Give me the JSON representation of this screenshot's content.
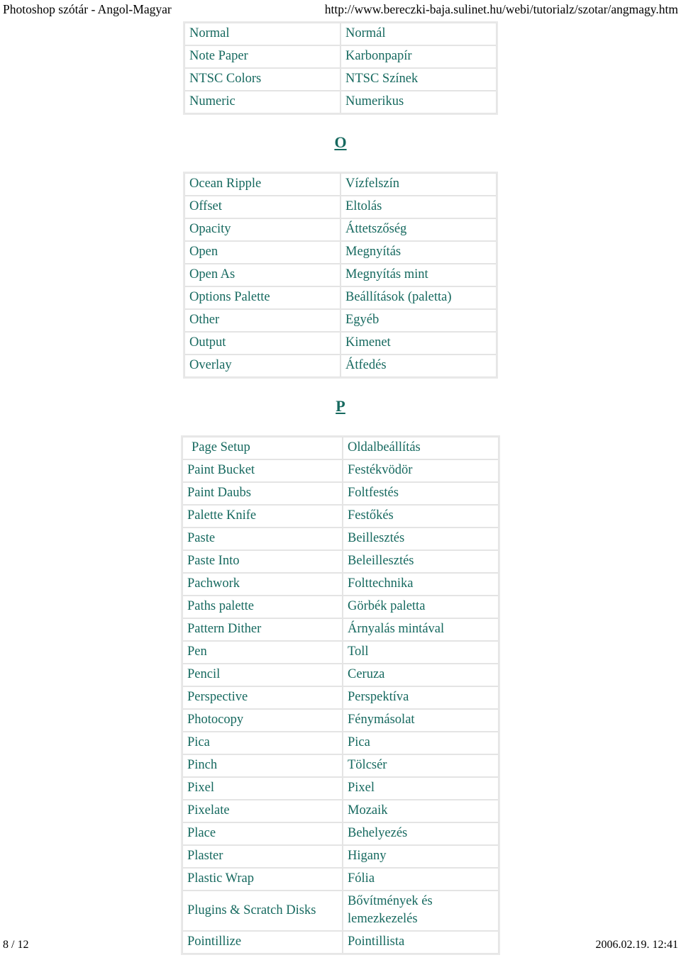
{
  "print_header": {
    "title": "Photoshop szótár - Angol-Magyar",
    "url": "http://www.bereczki-baja.sulinet.hu/webi/tutorialz/szotar/angmagy.htm"
  },
  "print_footer": {
    "page": "8 / 12",
    "timestamp": "2006.02.19. 12:41"
  },
  "colors": {
    "text_teal": "#16695f",
    "table_border": "#e4e4e4",
    "table_outer_border": "#e9e9e9",
    "header_text": "#000000",
    "background": "#ffffff"
  },
  "sections": [
    {
      "id": "section-n-continued",
      "letter": null,
      "rows": [
        {
          "en": "Normal",
          "hu": "Normál"
        },
        {
          "en": "Note Paper",
          "hu": "Karbonpapír"
        },
        {
          "en": "NTSC Colors",
          "hu": "NTSC Színek"
        },
        {
          "en": "Numeric",
          "hu": "Numerikus"
        }
      ]
    },
    {
      "id": "section-o",
      "letter": "O",
      "rows": [
        {
          "en": "Ocean Ripple",
          "hu": "Vízfelszín"
        },
        {
          "en": "Offset",
          "hu": "Eltolás"
        },
        {
          "en": "Opacity",
          "hu": "Áttetszőség"
        },
        {
          "en": "Open",
          "hu": "Megnyítás"
        },
        {
          "en": "Open As",
          "hu": "Megnyítás mint"
        },
        {
          "en": "Options Palette",
          "hu": "Beállítások (paletta)"
        },
        {
          "en": "Other",
          "hu": "Egyéb"
        },
        {
          "en": "Output",
          "hu": "Kimenet"
        },
        {
          "en": "Overlay",
          "hu": "Átfedés"
        }
      ]
    },
    {
      "id": "section-p",
      "letter": "P",
      "rows": [
        {
          "en": "Page Setup",
          "hu": "Oldalbeállítás",
          "indented": true
        },
        {
          "en": "Paint Bucket",
          "hu": "Festékvödör"
        },
        {
          "en": "Paint Daubs",
          "hu": "Foltfestés"
        },
        {
          "en": "Palette Knife",
          "hu": "Festőkés"
        },
        {
          "en": "Paste",
          "hu": "Beillesztés"
        },
        {
          "en": "Paste Into",
          "hu": "Beleillesztés"
        },
        {
          "en": "Pachwork",
          "hu": "Folttechnika"
        },
        {
          "en": "Paths palette",
          "hu": "Görbék paletta"
        },
        {
          "en": "Pattern Dither",
          "hu": "Árnyalás mintával"
        },
        {
          "en": "Pen",
          "hu": "Toll"
        },
        {
          "en": "Pencil",
          "hu": "Ceruza"
        },
        {
          "en": "Perspective",
          "hu": "Perspektíva"
        },
        {
          "en": "Photocopy",
          "hu": "Fénymásolat"
        },
        {
          "en": "Pica",
          "hu": "Pica"
        },
        {
          "en": "Pinch",
          "hu": "Tölcsér"
        },
        {
          "en": "Pixel",
          "hu": "Pixel"
        },
        {
          "en": "Pixelate",
          "hu": "Mozaik"
        },
        {
          "en": "Place",
          "hu": "Behelyezés"
        },
        {
          "en": "Plaster",
          "hu": "Higany"
        },
        {
          "en": "Plastic Wrap",
          "hu": "Fólia"
        },
        {
          "en": "Plugins & Scratch Disks",
          "hu": "Bővítmények és lemezkezelés"
        },
        {
          "en": "Pointillize",
          "hu": "Pointillista"
        }
      ]
    }
  ]
}
